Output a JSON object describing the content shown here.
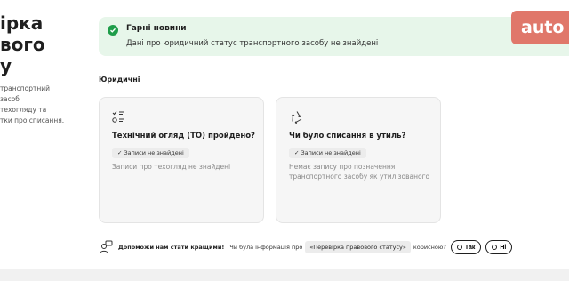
{
  "left_panel": {
    "title_fragment": "ірка\nвого\nу",
    "desc_fragment": "транспортний засоб\nтехогляду та\nтки про списання."
  },
  "banner": {
    "title": "Гарні новини",
    "text": "Дані про юридичний статус транспортного засобу не знайдені",
    "bg_color": "#e7f6ea",
    "icon": "check-circle-icon"
  },
  "brand": {
    "logo_text": "auto"
  },
  "section": {
    "title": "Юридичні"
  },
  "cards": [
    {
      "icon": "checklist-icon",
      "title": "Технічний огляд (ТО) пройдено?",
      "tag": "✓ Записи не знайдені",
      "text": "Записи про техогляд не знайдені"
    },
    {
      "icon": "recycle-icon",
      "title": "Чи було списання в утиль?",
      "tag": "✓ Записи не знайдені",
      "text": "Немає запису про позначення транспортного засобу як утилізованого"
    }
  ],
  "feedback": {
    "icon": "feedback-person-icon",
    "strong": "Допоможи нам стати кращими!",
    "question_before": "Чи була інформація про",
    "pill": "«Перевірка правового статусу»",
    "question_after": "корисною?",
    "yes_label": "Так",
    "no_label": "Ні"
  }
}
